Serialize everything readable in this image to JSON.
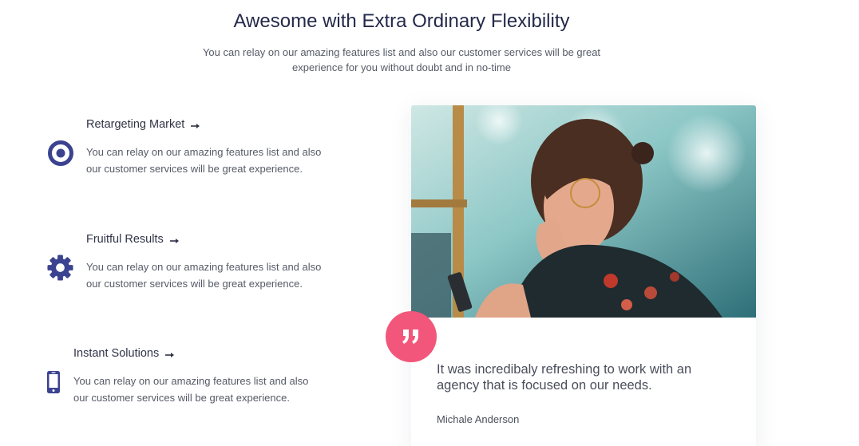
{
  "header": {
    "title": "Awesome with Extra Ordinary Flexibility",
    "subtitle": "You can relay on our amazing features list and also our customer services will be great experience for you without doubt and in no-time"
  },
  "features": [
    {
      "title": "Retargeting Market",
      "text": "You can relay on our amazing features list and also our customer services will be great experience.",
      "icon": "target-icon"
    },
    {
      "title": "Fruitful Results",
      "text": "You can relay on our amazing features list and also our customer services will be great experience.",
      "icon": "gear-icon"
    },
    {
      "title": "Instant Solutions",
      "text": "You can relay on our amazing features list and also our customer services will be great experience.",
      "icon": "mobile-phone-icon"
    }
  ],
  "testimonial": {
    "quote": "It was incredibaly refreshing to work with an agency that is focused on our needs.",
    "author": "Michale Anderson",
    "icon": "quote-icon"
  },
  "colors": {
    "accent_blue": "#3b4390",
    "accent_pink": "#f2567a",
    "heading": "#242a4a",
    "body_text": "#555a66"
  }
}
